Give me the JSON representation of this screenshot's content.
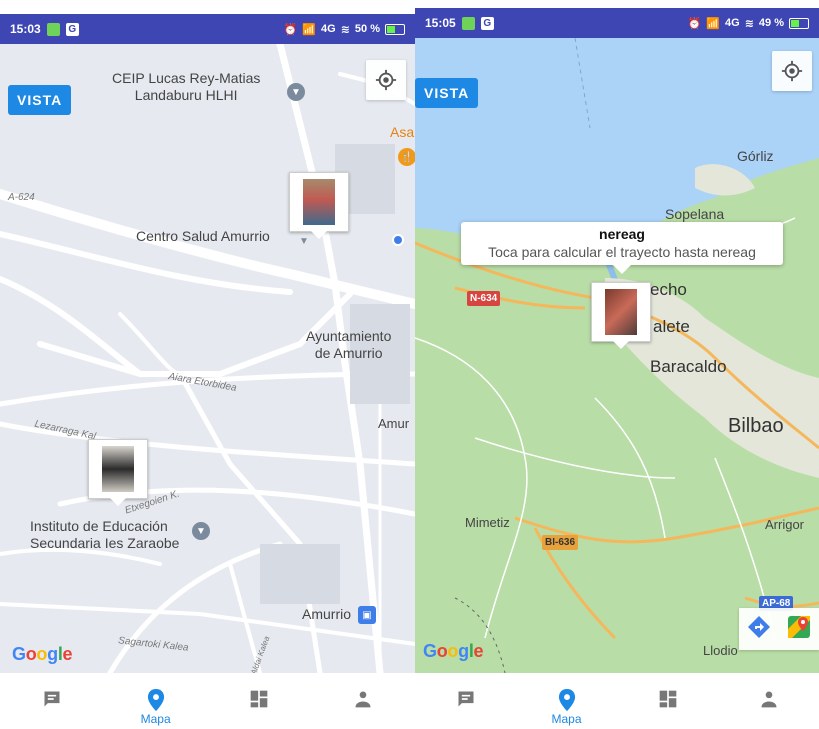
{
  "screens": {
    "left": {
      "status": {
        "time": "15:03",
        "icon_a": "G",
        "signal": "4G",
        "battery": "50 %"
      },
      "vista_label": "VISTA",
      "map_labels": {
        "school1_l1": "CEIP Lucas Rey-Matias",
        "school1_l2": "Landaburu HLHI",
        "asa": "Asa",
        "road_a624": "A-624",
        "centro_salud": "Centro Salud Amurrio",
        "ayto_l1": "Ayuntamiento",
        "ayto_l2": "de Amurrio",
        "aiara": "Aiara Etorbidea",
        "amur": "Amur",
        "lezarraga": "Lezarraga Kal",
        "etxegoien": "Etxegoien K.",
        "instituto_l1": "Instituto de Educación",
        "instituto_l2": "Secundaria Ies Zaraobe",
        "amurrio_station": "Amurrio",
        "sagartoki": "Sagartoki Kalea",
        "aldai": "Aldai Kalea"
      },
      "google": [
        "G",
        "o",
        "o",
        "g",
        "l",
        "e"
      ]
    },
    "right": {
      "status": {
        "time": "15:05",
        "icon_a": "G",
        "signal": "4G",
        "battery": "49 %"
      },
      "vista_label": "VISTA",
      "infowindow": {
        "title": "nereag",
        "subtitle": "Toca para calcular el trayecto hasta nereag"
      },
      "map_labels": {
        "gorliz": "Górliz",
        "sopelana": "Sopelana",
        "echo": "echo",
        "alete": "alete",
        "baracaldo": "Baracaldo",
        "bilbao": "Bilbao",
        "mimetiz": "Mimetiz",
        "arrigo": "Arrigor",
        "llodio": "Llodio"
      },
      "road_shields": {
        "n634": "N-634",
        "bi636": "BI-636",
        "ap68": "AP-68"
      },
      "google": [
        "G",
        "o",
        "o",
        "g",
        "l",
        "e"
      ]
    }
  },
  "nav": {
    "items": [
      {
        "name": "messages",
        "label": ""
      },
      {
        "name": "map",
        "label": "Mapa"
      },
      {
        "name": "dashboard",
        "label": ""
      },
      {
        "name": "profile",
        "label": ""
      }
    ]
  },
  "colors": {
    "statusbar": "#3d46b3",
    "accent": "#1e88e5",
    "road_orange": "#f5b75c",
    "sea": "#aad3f7"
  }
}
